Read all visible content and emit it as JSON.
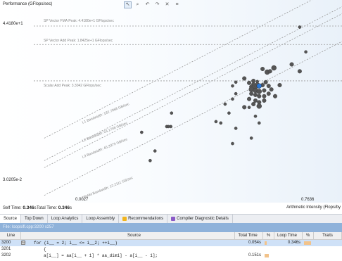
{
  "chart": {
    "y_title": "Performance (GFlops/sec)",
    "y_top_tick": "4.4180e+1",
    "y_bottom_tick": "3.0205e-2",
    "x_left_tick": "0.0027",
    "x_right_tick": "0.7636",
    "x_title": "Arithmetic Intensity (Flops/by",
    "roof_labels": {
      "fma": "SP Vector FMA Peak: 4.4180e+1 GFlops/sec",
      "add": "SP Vector Add Peak: 1.8425e+1 GFlops/sec",
      "scalar": "Scalar Add Peak: 3.3042 GFlops/sec",
      "l1": "L1 Bandwidth: 182.7068 GB/sec",
      "l2": "L2 Bandwidth: 63.1748 GB/sec",
      "l3": "L3 Bandwidth: 45.3379 GB/sec",
      "dram": "DRAM Bandwidth: 12.2111 GB/sec"
    },
    "toolbar_icons": [
      "cursor-icon",
      "zoom-icon",
      "undo-icon",
      "redo-icon",
      "close-icon",
      "settings-icon"
    ]
  },
  "chart_data": {
    "type": "scatter",
    "title": "",
    "ylabel": "Performance (GFlops/sec)",
    "xlabel": "Arithmetic Intensity (Flops/by",
    "xlim": [
      0.0027,
      0.7636
    ],
    "ylim": [
      0.030205,
      44.18
    ],
    "log_scale": true,
    "horizontal_roofs": [
      {
        "name": "SP Vector FMA Peak",
        "value": 44.18
      },
      {
        "name": "SP Vector Add Peak",
        "value": 18.425
      },
      {
        "name": "Scalar Add Peak",
        "value": 3.3042
      }
    ],
    "bandwidth_roofs": [
      {
        "name": "L1 Bandwidth",
        "value": 182.7068
      },
      {
        "name": "L2 Bandwidth",
        "value": 63.1748
      },
      {
        "name": "L3 Bandwidth",
        "value": 45.3379
      },
      {
        "name": "DRAM Bandwidth",
        "value": 12.2111
      }
    ],
    "points": [
      {
        "x": 0.62,
        "y": 42.0,
        "s": 3
      },
      {
        "x": 0.72,
        "y": 13.0,
        "s": 3
      },
      {
        "x": 0.51,
        "y": 7.2,
        "s": 4
      },
      {
        "x": 0.62,
        "y": 5.2,
        "s": 4
      },
      {
        "x": 0.25,
        "y": 5.8,
        "s": 4
      },
      {
        "x": 0.28,
        "y": 5.0,
        "s": 5
      },
      {
        "x": 0.33,
        "y": 6.1,
        "s": 5
      },
      {
        "x": 0.3,
        "y": 5.2,
        "s": 4
      },
      {
        "x": 0.16,
        "y": 3.7,
        "s": 4
      },
      {
        "x": 0.18,
        "y": 3.0,
        "s": 4
      },
      {
        "x": 0.2,
        "y": 3.3,
        "s": 4
      },
      {
        "x": 0.22,
        "y": 3.2,
        "s": 3
      },
      {
        "x": 0.27,
        "y": 3.1,
        "s": 4
      },
      {
        "x": 0.2,
        "y": 2.8,
        "s": 4
      },
      {
        "x": 0.22,
        "y": 2.8,
        "s": 4
      },
      {
        "x": 0.25,
        "y": 2.7,
        "s": 4
      },
      {
        "x": 0.19,
        "y": 2.5,
        "s": 4
      },
      {
        "x": 0.21,
        "y": 2.4,
        "s": 4
      },
      {
        "x": 0.23,
        "y": 2.6,
        "s": 5
      },
      {
        "x": 0.29,
        "y": 2.6,
        "s": 4
      },
      {
        "x": 0.19,
        "y": 2.2,
        "s": 5
      },
      {
        "x": 0.21,
        "y": 2.1,
        "s": 5
      },
      {
        "x": 0.23,
        "y": 2.0,
        "s": 5
      },
      {
        "x": 0.26,
        "y": 2.1,
        "s": 4
      },
      {
        "x": 0.31,
        "y": 2.2,
        "s": 4
      },
      {
        "x": 0.19,
        "y": 1.8,
        "s": 4
      },
      {
        "x": 0.21,
        "y": 1.7,
        "s": 4
      },
      {
        "x": 0.23,
        "y": 1.6,
        "s": 4
      },
      {
        "x": 0.26,
        "y": 1.6,
        "s": 4
      },
      {
        "x": 0.29,
        "y": 1.8,
        "s": 4
      },
      {
        "x": 0.18,
        "y": 1.4,
        "s": 4
      },
      {
        "x": 0.21,
        "y": 1.3,
        "s": 4
      },
      {
        "x": 0.23,
        "y": 1.2,
        "s": 4
      },
      {
        "x": 0.26,
        "y": 1.3,
        "s": 4
      },
      {
        "x": 0.2,
        "y": 1.1,
        "s": 4
      },
      {
        "x": 0.23,
        "y": 1.0,
        "s": 5
      },
      {
        "x": 0.38,
        "y": 2.7,
        "s": 4
      },
      {
        "x": 0.34,
        "y": 1.6,
        "s": 4
      },
      {
        "x": 0.18,
        "y": 0.94,
        "s": 3
      },
      {
        "x": 0.16,
        "y": 0.95,
        "s": 4
      },
      {
        "x": 0.13,
        "y": 1.8,
        "s": 3
      },
      {
        "x": 0.12,
        "y": 2.6,
        "s": 3
      },
      {
        "x": 0.13,
        "y": 3.1,
        "s": 3
      },
      {
        "x": 0.12,
        "y": 1.4,
        "s": 3
      },
      {
        "x": 0.1,
        "y": 1.1,
        "s": 3
      },
      {
        "x": 0.09,
        "y": 0.45,
        "s": 3
      },
      {
        "x": 0.11,
        "y": 0.72,
        "s": 3
      },
      {
        "x": 0.13,
        "y": 0.35,
        "s": 3
      },
      {
        "x": 0.21,
        "y": 0.62,
        "s": 3
      },
      {
        "x": 0.23,
        "y": 0.45,
        "s": 3
      },
      {
        "x": 0.08,
        "y": 0.48,
        "s": 3
      },
      {
        "x": 0.19,
        "y": 0.22,
        "s": 3
      },
      {
        "x": 0.12,
        "y": 0.17,
        "s": 3
      },
      {
        "x": 0.027,
        "y": 0.72,
        "s": 3
      },
      {
        "x": 0.024,
        "y": 0.38,
        "s": 3
      },
      {
        "x": 0.025,
        "y": 0.38,
        "s": 3
      },
      {
        "x": 0.0265,
        "y": 0.38,
        "s": 3
      },
      {
        "x": 0.013,
        "y": 0.29,
        "s": 3
      },
      {
        "x": 0.018,
        "y": 0.12,
        "s": 3
      },
      {
        "x": 0.016,
        "y": 0.076,
        "s": 3
      }
    ],
    "highlight": {
      "x": 0.23,
      "y": 2.6
    }
  },
  "times": {
    "self_label": "Self Time:",
    "self_value": "0.346",
    "self_unit": "s",
    "total_label": "Total Time:",
    "total_value": "0.346",
    "total_unit": "s"
  },
  "tabs": [
    {
      "label": "Source",
      "icon": "",
      "color": ""
    },
    {
      "label": "Top Down",
      "icon": "",
      "color": ""
    },
    {
      "label": "Loop Analytics",
      "icon": "",
      "color": ""
    },
    {
      "label": "Loop Assembly",
      "icon": "",
      "color": ""
    },
    {
      "label": "Recommendations",
      "icon": "lightbulb-icon",
      "color": "#f2b51d"
    },
    {
      "label": "Compiler Diagnostic Details",
      "icon": "diagnostic-icon",
      "color": "#8a5ac7"
    }
  ],
  "file_path": "File: loopsifl.cpp:3200 s257",
  "table": {
    "headers": {
      "line": "Line",
      "source": "Source",
      "total_time": "Total Time",
      "pct1": "%",
      "loop_time": "Loop Time",
      "pct2": "%",
      "traits": "Traits"
    },
    "rows": [
      {
        "line": "3200",
        "expander": "⊟",
        "source": "for (i__ = 2; i__ <= i__2; ++i__)",
        "total_time": "0.054s",
        "loop_time": "0.346s",
        "selected": true
      },
      {
        "line": "3201",
        "expander": "",
        "source": "{",
        "total_time": "",
        "loop_time": "",
        "selected": false
      },
      {
        "line": "3202",
        "expander": "",
        "source": "a[i__] = aa[i__ + 1] * aa_dim1] - a[i__ - 1];",
        "total_time": "0.151s",
        "loop_time": "",
        "selected": false
      }
    ]
  },
  "colors": {
    "point": "#555555",
    "point_highlight": "#2b78d6",
    "roof": "#999999",
    "selected_row": "#cfe1f7",
    "file_bar": "#8fb2da",
    "time_bar": "#f2c38b"
  }
}
